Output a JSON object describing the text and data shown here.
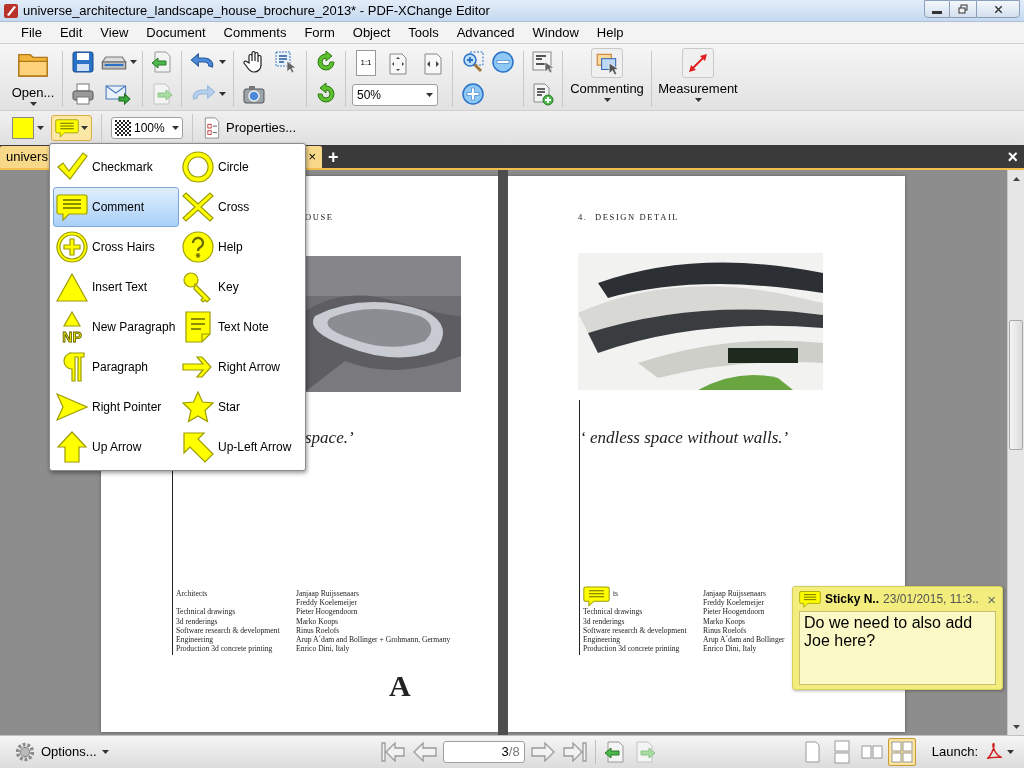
{
  "window": {
    "title": "universe_architecture_landscape_house_brochure_2013* - PDF-XChange Editor"
  },
  "menu": [
    "File",
    "Edit",
    "View",
    "Document",
    "Comments",
    "Form",
    "Object",
    "Tools",
    "Advanced",
    "Window",
    "Help"
  ],
  "toolbar": {
    "open_label": "Open...",
    "actual_size_label": "1:1",
    "zoom_value": "50%",
    "commenting_label": "Commenting",
    "measurement_label": "Measurement"
  },
  "comment_toolbar": {
    "icon_menu_expanded": true,
    "opacity_value": "100%",
    "properties_label": "Properties..."
  },
  "tabs": {
    "documents": [
      {
        "label": "univers",
        "selected": true
      }
    ],
    "tab_close": "×",
    "new_tab": "+",
    "close_all": "×"
  },
  "icon_menu": [
    {
      "label": "Checkmark",
      "selected": false
    },
    {
      "label": "Circle",
      "selected": false
    },
    {
      "label": "Comment",
      "selected": true
    },
    {
      "label": "Cross",
      "selected": false
    },
    {
      "label": "Cross Hairs",
      "selected": false
    },
    {
      "label": "Help",
      "selected": false
    },
    {
      "label": "Insert Text",
      "selected": false
    },
    {
      "label": "Key",
      "selected": false
    },
    {
      "label": "New Paragraph",
      "selected": false,
      "icon_text": "NP"
    },
    {
      "label": "Text Note",
      "selected": false
    },
    {
      "label": "Paragraph",
      "selected": false
    },
    {
      "label": "Right Arrow",
      "selected": false
    },
    {
      "label": "Right Pointer",
      "selected": false
    },
    {
      "label": "Star",
      "selected": false
    },
    {
      "label": "Up Arrow",
      "selected": false
    },
    {
      "label": "Up-Left Arrow",
      "selected": false
    }
  ],
  "pages": [
    {
      "heading": "OUSE",
      "quote": "space.’",
      "comment_marker": false,
      "logo": "A",
      "credits": [
        {
          "role": "Architects",
          "name": "Janjaap Ruijssenaars"
        },
        {
          "name": "Freddy Koelemeijer"
        },
        {
          "role": "Technical drawings",
          "name": "Pieter Hoogendoorn"
        },
        {
          "role": "3d renderings",
          "name": "Marko Koops"
        },
        {
          "role": "Software research & development",
          "name": "Rinus Roelofs"
        },
        {
          "role": "Engineering",
          "name": "Arup A´dam and Bollinger + Grohmann, Germany"
        },
        {
          "role": "Production 3d concrete printing",
          "name": "Enrico Dini, Italy"
        }
      ]
    },
    {
      "heading": "4.  DESIGN DETAIL",
      "quote": "‘ endless space without walls.’",
      "comment_marker": true,
      "credits": [
        {
          "role": "ts",
          "name": "Janjaap Ruijssenaars"
        },
        {
          "name": "Freddy Koelemeijer"
        },
        {
          "role": "Technical drawings",
          "name": "Pieter Hoogendoorn"
        },
        {
          "role": "3d renderings",
          "name": "Marko Koops"
        },
        {
          "role": "Software research & development",
          "name": "Rinus Roelofs"
        },
        {
          "role": "Engineering",
          "name": "Arup A´dam and Bollinger"
        },
        {
          "role": "Production 3d concrete printing",
          "name": "Enrico Dini, Italy"
        }
      ]
    }
  ],
  "sticky_note": {
    "title": "Sticky N..",
    "date": "23/01/2015, 11:3..",
    "close": "×",
    "text": "Do we need to also add Joe here?"
  },
  "status_bar": {
    "options_label": "Options...",
    "page_number": "3",
    "page_count": "/8",
    "layouts": [
      {
        "selected": false
      },
      {
        "selected": false
      },
      {
        "selected": false
      },
      {
        "selected": true
      }
    ],
    "launch_label": "Launch:"
  }
}
